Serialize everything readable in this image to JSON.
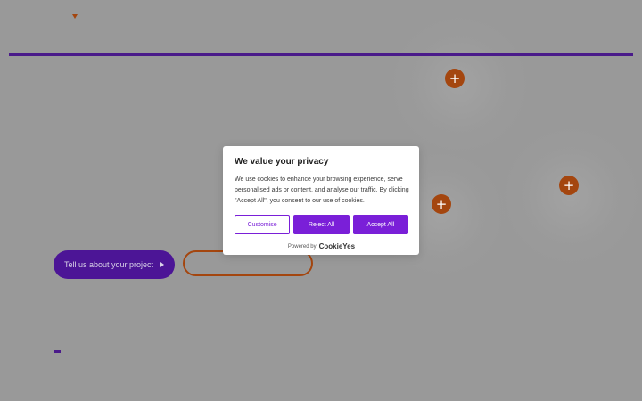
{
  "hero": {
    "cta_primary_label": "Tell us about your project",
    "cta_primary_icon": "play-triangle-icon",
    "cta_secondary_label": ""
  },
  "plus_buttons": [
    "+",
    "+",
    "+"
  ],
  "colors": {
    "accent_purple": "#4c1596",
    "accent_orange": "#a4460f",
    "consent_purple": "#7a1fd8"
  },
  "consent": {
    "title": "We value your privacy",
    "body": "We use cookies to enhance your browsing experience, serve personalised ads or content, and analyse our traffic. By clicking \"Accept All\", you consent to our use of cookies.",
    "customise_label": "Customise",
    "reject_label": "Reject All",
    "accept_label": "Accept All",
    "powered_by": "Powered by",
    "brand": "CookieYes"
  }
}
